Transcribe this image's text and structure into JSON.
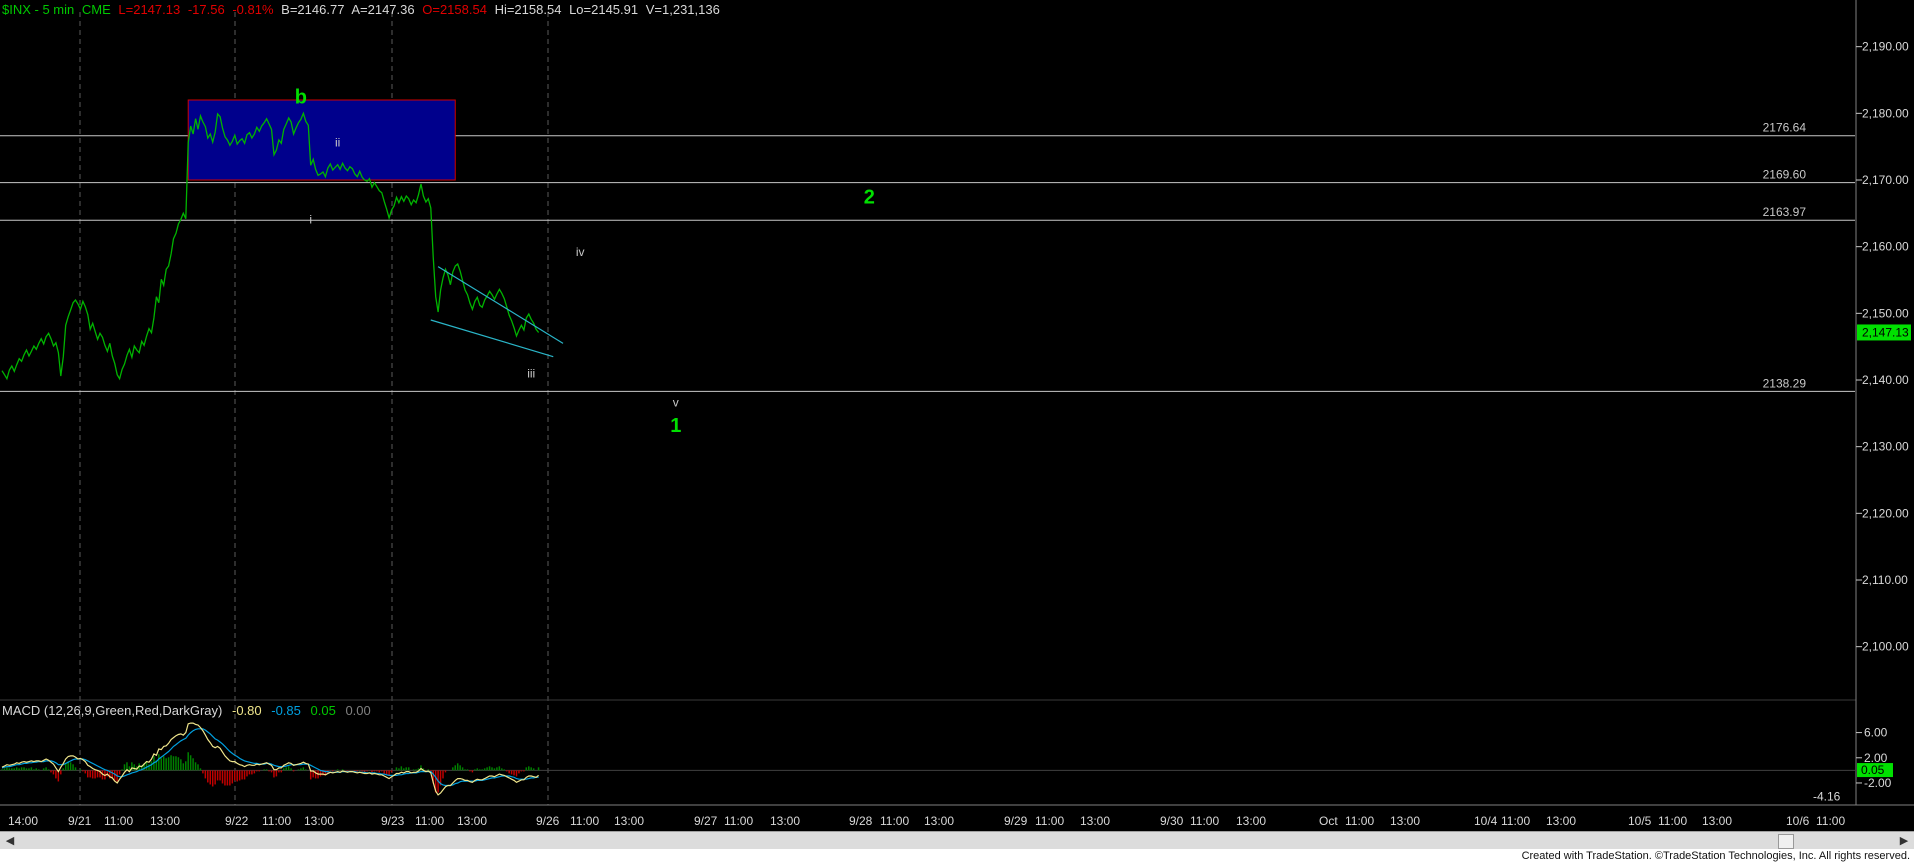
{
  "header": {
    "symbol": "$INX - 5 min",
    "exchange": "CME",
    "last": "L=2147.13",
    "change": "-17.56",
    "change_pct": "-0.81%",
    "bid": "B=2146.77",
    "ask": "A=2147.36",
    "open": "O=2158.54",
    "high": "Hi=2158.54",
    "low": "Lo=2145.91",
    "volume": "V=1,231,136"
  },
  "macd": {
    "label": "MACD (12,26,9,Green,Red,DarkGray)",
    "v1": "-0.80",
    "v2": "-0.85",
    "v3": "0.05",
    "v4": "0.00",
    "axis_ticks": [
      "6.00",
      "2.00",
      "-2.00"
    ],
    "badge_value": "0.05",
    "low_marker": "-4.16"
  },
  "colors": {
    "price": "#00b400",
    "wave_green": "#00e000",
    "box_fill": "#00008c",
    "box_stroke": "#d00000",
    "channel": "#2ab5c8",
    "level_line": "#c8c8c8",
    "macd_line": "#f0e68c",
    "signal_line": "#00a0e0",
    "hist_up": "#008000",
    "hist_down": "#c00000"
  },
  "chart_data": {
    "type": "line",
    "price_axis": {
      "ylim": [
        2092,
        2197
      ],
      "ticks": [
        "2,190.00",
        "2,180.00",
        "2,170.00",
        "2,160.00",
        "2,150.00",
        "2,140.00",
        "2,130.00",
        "2,120.00",
        "2,110.00",
        "2,100.00"
      ],
      "current": "2,147.13"
    },
    "time_axis": {
      "labels": [
        "14:00",
        "9/21",
        "11:00",
        "13:00",
        "9/22",
        "11:00",
        "13:00",
        "9/23",
        "11:00",
        "13:00",
        "9/26",
        "11:00",
        "13:00",
        "9/27",
        "11:00",
        "13:00",
        "9/28",
        "11:00",
        "13:00",
        "9/29",
        "11:00",
        "13:00",
        "9/30",
        "11:00",
        "13:00",
        "Oct",
        "11:00",
        "13:00",
        "10/4",
        "11:00",
        "13:00",
        "10/5",
        "11:00",
        "13:00",
        "10/6",
        "11:00"
      ]
    },
    "levels": [
      {
        "value": 2176.64,
        "label": "2176.64"
      },
      {
        "value": 2169.6,
        "label": "2169.60"
      },
      {
        "value": 2163.97,
        "label": "2163.97"
      },
      {
        "value": 2138.29,
        "label": "2138.29"
      }
    ],
    "box": {
      "bar_from": 76,
      "bar_to": 185,
      "price_high": 2182,
      "price_low": 2170
    },
    "wave_labels": [
      {
        "text": "b",
        "bar": 122,
        "price": 2181.5,
        "style": "major"
      },
      {
        "text": "i",
        "bar": 126,
        "price": 2163.5,
        "style": "minor"
      },
      {
        "text": "ii",
        "bar": 137,
        "price": 2175.0,
        "style": "minor"
      },
      {
        "text": "iii",
        "bar": 216,
        "price": 2140.4,
        "style": "minor"
      },
      {
        "text": "iv",
        "bar": 236,
        "price": 2158.6,
        "style": "minor"
      },
      {
        "text": "v",
        "bar": 275,
        "price": 2136.0,
        "style": "minor"
      },
      {
        "text": "1",
        "bar": 275,
        "price": 2132.2,
        "style": "major"
      },
      {
        "text": "2",
        "bar": 354,
        "price": 2166.5,
        "style": "major"
      }
    ],
    "channel": [
      {
        "from": [
          178,
          2157.0
        ],
        "to": [
          229,
          2145.5
        ]
      },
      {
        "from": [
          175,
          2149.0
        ],
        "to": [
          225,
          2143.5
        ]
      }
    ],
    "series": [
      {
        "values": [
          2141.4,
          2140.8,
          2140.2,
          2141.5,
          2142.1,
          2141.3,
          2142.3,
          2143.2,
          2142.8,
          2143.8,
          2144.5,
          2143.6,
          2144.3,
          2145.1,
          2144.6,
          2145.5,
          2146.2,
          2145.4,
          2146.5,
          2147.0,
          2146.2,
          2145.1,
          2145.6,
          2144.1,
          2140.6,
          2143.5,
          2148.2,
          2149.5,
          2150.5,
          2151.6,
          2152.0,
          2151.4,
          2150.6,
          2151.8,
          2151.0,
          2149.8,
          2147.6,
          2148.5,
          2147.3,
          2146.1,
          2147.0,
          2146.4,
          2145.2,
          2144.3,
          2145.5,
          2143.6,
          2142.5,
          2140.8,
          2140.2,
          2141.6,
          2142.4,
          2143.7,
          2144.6,
          2143.4,
          2145.1,
          2144.5,
          2144.1,
          2145.8,
          2145.2,
          2146.6,
          2147.7,
          2147.1,
          2149.3,
          2152.5,
          2151.6,
          2155.1,
          2154.2,
          2156.6,
          2157.1,
          2158.9,
          2161.2,
          2162.0,
          2163.4,
          2164.1,
          2165.0,
          2164.2,
          2175.6,
          2178.1,
          2176.9,
          2179.2,
          2177.6,
          2179.6,
          2178.7,
          2178.0,
          2176.3,
          2176.9,
          2175.7,
          2177.2,
          2179.9,
          2179.5,
          2177.8,
          2176.5,
          2176.0,
          2175.2,
          2175.8,
          2176.7,
          2175.4,
          2175.9,
          2176.2,
          2175.5,
          2176.8,
          2177.1,
          2176.3,
          2176.9,
          2177.9,
          2177.3,
          2178.1,
          2178.6,
          2179.2,
          2178.4,
          2177.6,
          2173.8,
          2174.5,
          2176.0,
          2175.5,
          2177.6,
          2178.4,
          2179.3,
          2178.7,
          2176.9,
          2177.8,
          2178.6,
          2179.1,
          2180.0,
          2178.8,
          2178.2,
          2172.2,
          2173.1,
          2171.6,
          2170.7,
          2170.9,
          2171.2,
          2170.5,
          2171.8,
          2172.4,
          2171.5,
          2171.9,
          2172.3,
          2171.6,
          2172.5,
          2171.8,
          2171.4,
          2172.0,
          2171.7,
          2170.9,
          2170.5,
          2171.3,
          2170.4,
          2170.0,
          2169.8,
          2170.2,
          2168.9,
          2169.6,
          2169.0,
          2168.4,
          2168.1,
          2166.8,
          2165.6,
          2164.3,
          2165.5,
          2166.1,
          2167.4,
          2166.6,
          2167.5,
          2166.8,
          2167.6,
          2167.2,
          2166.3,
          2167.0,
          2166.6,
          2167.8,
          2169.4,
          2167.6,
          2166.7,
          2167.2,
          2165.8,
          2158.5,
          2152.5,
          2150.2,
          2153.5,
          2155.3,
          2156.6,
          2155.8,
          2154.3,
          2156.2,
          2157.1,
          2157.4,
          2156.3,
          2154.9,
          2153.5,
          2152.8,
          2151.5,
          2150.6,
          2151.8,
          2152.4,
          2151.2,
          2150.9,
          2152.0,
          2152.6,
          2153.3,
          2152.8,
          2152.1,
          2152.9,
          2153.6,
          2153.0,
          2152.2,
          2151.0,
          2149.7,
          2148.9,
          2147.8,
          2146.6,
          2147.5,
          2148.2,
          2147.5,
          2149.3,
          2149.9,
          2149.1,
          2148.5,
          2147.6,
          2147.13
        ]
      }
    ],
    "macd_series": {
      "ylim": [
        -5.5,
        8
      ],
      "macd": [
        0.5,
        0.7,
        0.9,
        0.8,
        0.9,
        1.0,
        1.2,
        1.1,
        1.3,
        1.4,
        1.3,
        1.4,
        1.5,
        1.4,
        1.5,
        1.5,
        1.4,
        1.6,
        1.8,
        1.6,
        1.3,
        1.0,
        0.4,
        -0.2,
        0.5,
        1.1,
        1.8,
        2.2,
        2.3,
        2.3,
        2.1,
        1.8,
        1.9,
        1.7,
        1.4,
        0.8,
        0.6,
        0.3,
        0.1,
        0.0,
        -0.2,
        -0.6,
        -0.8,
        -0.6,
        -1.0,
        -1.2,
        -1.7,
        -2.0,
        -1.4,
        -0.9,
        -0.3,
        0.1,
        -0.2,
        0.4,
        0.3,
        0.2,
        0.7,
        0.6,
        1.0,
        1.4,
        1.3,
        1.8,
        2.6,
        2.4,
        3.4,
        3.3,
        3.8,
        3.9,
        4.3,
        4.9,
        5.2,
        5.5,
        5.7,
        5.8,
        5.6,
        6.0,
        7.4,
        7.5,
        7.5,
        7.3,
        7.2,
        6.8,
        6.3,
        5.6,
        4.9,
        4.4,
        3.8,
        3.6,
        3.8,
        3.5,
        2.9,
        2.3,
        1.9,
        1.5,
        1.4,
        1.4,
        1.1,
        0.9,
        0.8,
        0.6,
        0.8,
        0.9,
        0.8,
        0.8,
        1.0,
        0.9,
        1.0,
        1.1,
        1.2,
        1.0,
        0.8,
        0.1,
        0.1,
        0.4,
        0.4,
        0.8,
        1.0,
        1.2,
        1.1,
        0.8,
        0.9,
        1.0,
        1.1,
        1.3,
        1.1,
        1.0,
        -0.1,
        -0.1,
        -0.4,
        -0.6,
        -0.6,
        -0.6,
        -0.7,
        -0.5,
        -0.3,
        -0.4,
        -0.3,
        -0.2,
        -0.3,
        -0.1,
        -0.2,
        -0.3,
        -0.2,
        -0.2,
        -0.3,
        -0.4,
        -0.3,
        -0.4,
        -0.5,
        -0.5,
        -0.4,
        -0.6,
        -0.5,
        -0.6,
        -0.7,
        -0.7,
        -0.9,
        -1.1,
        -1.3,
        -1.0,
        -0.8,
        -0.5,
        -0.5,
        -0.3,
        -0.4,
        -0.2,
        -0.2,
        -0.4,
        -0.3,
        -0.3,
        -0.1,
        0.3,
        0.0,
        -0.2,
        -0.1,
        -0.4,
        -1.9,
        -3.3,
        -3.9,
        -3.6,
        -3.1,
        -2.6,
        -2.4,
        -2.4,
        -2.0,
        -1.6,
        -1.3,
        -1.3,
        -1.4,
        -1.6,
        -1.6,
        -1.8,
        -1.9,
        -1.6,
        -1.4,
        -1.5,
        -1.5,
        -1.3,
        -1.1,
        -0.9,
        -0.9,
        -1.0,
        -0.8,
        -0.6,
        -0.7,
        -0.8,
        -1.0,
        -1.2,
        -1.4,
        -1.6,
        -1.9,
        -1.7,
        -1.5,
        -1.5,
        -1.1,
        -0.9,
        -0.9,
        -1.0,
        -1.1,
        -0.8
      ],
      "signal": [
        0.4,
        0.5,
        0.6,
        0.6,
        0.7,
        0.8,
        0.9,
        0.9,
        1.0,
        1.1,
        1.1,
        1.2,
        1.2,
        1.3,
        1.3,
        1.4,
        1.4,
        1.4,
        1.5,
        1.5,
        1.5,
        1.4,
        1.2,
        0.9,
        0.9,
        0.9,
        1.1,
        1.3,
        1.5,
        1.7,
        1.8,
        1.8,
        1.8,
        1.8,
        1.7,
        1.5,
        1.3,
        1.1,
        0.9,
        0.7,
        0.5,
        0.3,
        0.1,
        0.0,
        -0.2,
        -0.4,
        -0.6,
        -0.9,
        -1.0,
        -1.0,
        -0.9,
        -0.7,
        -0.6,
        -0.4,
        -0.3,
        -0.2,
        0.0,
        0.1,
        0.3,
        0.5,
        0.7,
        0.9,
        1.2,
        1.4,
        1.8,
        2.1,
        2.4,
        2.7,
        3.0,
        3.4,
        3.8,
        4.1,
        4.4,
        4.7,
        4.9,
        5.1,
        5.6,
        6.0,
        6.3,
        6.5,
        6.6,
        6.6,
        6.6,
        6.4,
        6.1,
        5.8,
        5.4,
        5.0,
        4.8,
        4.5,
        4.2,
        3.8,
        3.4,
        3.0,
        2.7,
        2.4,
        2.2,
        1.9,
        1.7,
        1.5,
        1.4,
        1.3,
        1.2,
        1.1,
        1.1,
        1.0,
        1.0,
        1.0,
        1.1,
        1.1,
        1.0,
        0.8,
        0.7,
        0.6,
        0.6,
        0.6,
        0.7,
        0.8,
        0.9,
        0.9,
        0.9,
        0.9,
        0.9,
        1.0,
        1.0,
        1.0,
        0.8,
        0.6,
        0.4,
        0.2,
        0.0,
        -0.1,
        -0.2,
        -0.2,
        -0.3,
        -0.3,
        -0.3,
        -0.3,
        -0.3,
        -0.2,
        -0.2,
        -0.2,
        -0.2,
        -0.2,
        -0.2,
        -0.3,
        -0.3,
        -0.3,
        -0.3,
        -0.4,
        -0.4,
        -0.4,
        -0.4,
        -0.5,
        -0.5,
        -0.6,
        -0.6,
        -0.7,
        -0.8,
        -0.8,
        -0.8,
        -0.8,
        -0.7,
        -0.7,
        -0.6,
        -0.5,
        -0.5,
        -0.4,
        -0.4,
        -0.4,
        -0.3,
        -0.2,
        -0.2,
        -0.2,
        -0.2,
        -0.2,
        -0.6,
        -1.1,
        -1.7,
        -2.1,
        -2.3,
        -2.4,
        -2.4,
        -2.4,
        -2.3,
        -2.1,
        -2.0,
        -1.8,
        -1.7,
        -1.7,
        -1.7,
        -1.7,
        -1.7,
        -1.7,
        -1.6,
        -1.6,
        -1.6,
        -1.5,
        -1.4,
        -1.3,
        -1.2,
        -1.2,
        -1.1,
        -1.0,
        -0.9,
        -0.9,
        -0.9,
        -0.9,
        -1.0,
        -1.1,
        -1.3,
        -1.4,
        -1.4,
        -1.4,
        -1.4,
        -1.3,
        -1.2,
        -1.2,
        -1.1,
        -1.1
      ]
    }
  },
  "footer": {
    "copyright": "Created with TradeStation. ©TradeStation Technologies, Inc. All rights reserved."
  }
}
